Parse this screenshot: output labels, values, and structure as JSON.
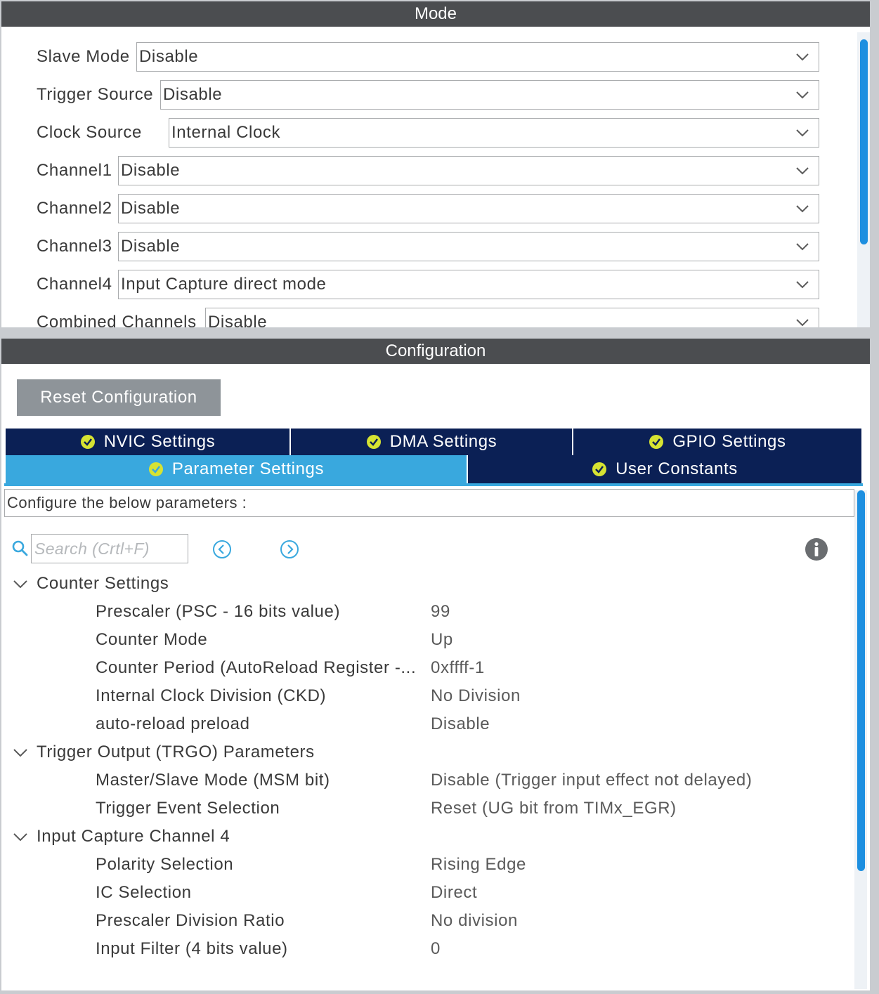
{
  "mode_panel": {
    "title": "Mode",
    "fields": [
      {
        "label": "Slave Mode",
        "value": "Disable"
      },
      {
        "label": "Trigger Source",
        "value": "Disable"
      },
      {
        "label": "Clock Source",
        "value": "Internal Clock"
      },
      {
        "label": "Channel1",
        "value": "Disable"
      },
      {
        "label": "Channel2",
        "value": "Disable"
      },
      {
        "label": "Channel3",
        "value": "Disable"
      },
      {
        "label": "Channel4",
        "value": "Input Capture direct mode"
      },
      {
        "label": "Combined Channels",
        "value": "Disable"
      }
    ]
  },
  "config_panel": {
    "title": "Configuration",
    "reset_label": "Reset Configuration",
    "tabs": [
      {
        "label": "NVIC Settings",
        "active": false
      },
      {
        "label": "DMA Settings",
        "active": false
      },
      {
        "label": "GPIO Settings",
        "active": false
      },
      {
        "label": "Parameter Settings",
        "active": true
      },
      {
        "label": "User Constants",
        "active": false
      }
    ],
    "description": "Configure the below parameters :",
    "search_placeholder": "Search (Crtl+F)",
    "groups": [
      {
        "title": "Counter Settings",
        "params": [
          {
            "name": "Prescaler (PSC - 16 bits value)",
            "value": "99"
          },
          {
            "name": "Counter Mode",
            "value": "Up"
          },
          {
            "name": "Counter Period (AutoReload Register -...",
            "value": "0xffff-1"
          },
          {
            "name": "Internal Clock Division (CKD)",
            "value": "No Division"
          },
          {
            "name": "auto-reload preload",
            "value": "Disable"
          }
        ]
      },
      {
        "title": "Trigger Output (TRGO) Parameters",
        "params": [
          {
            "name": "Master/Slave Mode (MSM bit)",
            "value": "Disable (Trigger input effect not delayed)"
          },
          {
            "name": "Trigger Event Selection",
            "value": "Reset (UG bit from TIMx_EGR)"
          }
        ]
      },
      {
        "title": "Input Capture Channel 4",
        "params": [
          {
            "name": "Polarity Selection",
            "value": "Rising Edge"
          },
          {
            "name": "IC Selection",
            "value": "Direct"
          },
          {
            "name": "Prescaler Division Ratio",
            "value": "No division"
          },
          {
            "name": "Input Filter (4 bits value)",
            "value": "0"
          }
        ]
      }
    ]
  },
  "colors": {
    "header_bg": "#4b4d50",
    "tab_bg": "#0b2055",
    "tab_active_bg": "#39a8de",
    "check_yellow": "#d6e332",
    "scrollbar": "#1d8fe0",
    "reset_button_bg": "#8e9499"
  },
  "icons": {
    "select_arrow": "chevron-down-icon",
    "tab_status": "check-circle-icon",
    "search": "search-icon",
    "prev": "circle-left-icon",
    "next": "circle-right-icon",
    "info": "info-icon",
    "group_expander": "chevron-down-icon"
  }
}
